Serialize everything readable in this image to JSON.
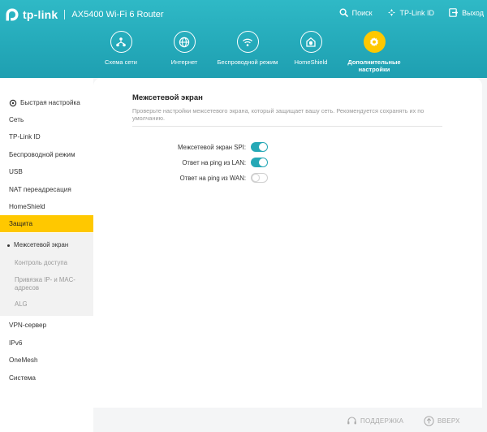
{
  "header": {
    "brand": "tp-link",
    "model": "AX5400 Wi-Fi 6 Router",
    "links": [
      {
        "label": "Поиск",
        "icon": "search-icon"
      },
      {
        "label": "TP-Link ID",
        "icon": "user-id-icon"
      },
      {
        "label": "Выход",
        "icon": "logout-icon"
      }
    ],
    "nav": [
      {
        "label": "Схема сети",
        "icon": "network-map-icon",
        "active": false
      },
      {
        "label": "Интернет",
        "icon": "globe-icon",
        "active": false
      },
      {
        "label": "Беспроводной режим",
        "icon": "wifi-icon",
        "active": false
      },
      {
        "label": "HomeShield",
        "icon": "homeshield-icon",
        "active": false
      },
      {
        "label": "Дополнительные настройки",
        "icon": "gear-icon",
        "active": true
      }
    ],
    "accent_color": "#ffc800",
    "header_color": "#24a9b9"
  },
  "sidebar": {
    "items": [
      {
        "label": "Быстрая настройка",
        "icon": "quick-setup-icon"
      },
      {
        "label": "Сеть"
      },
      {
        "label": "TP-Link ID"
      },
      {
        "label": "Беспроводной режим"
      },
      {
        "label": "USB"
      },
      {
        "label": "NAT переадресация"
      },
      {
        "label": "HomeShield"
      },
      {
        "label": "Защита",
        "active": true
      }
    ],
    "sub_items": [
      {
        "label": "Межсетевой экран",
        "active": true
      },
      {
        "label": "Контроль доступа"
      },
      {
        "label": "Привязка IP- и MAC-адресов"
      },
      {
        "label": "ALG"
      }
    ],
    "more_items": [
      {
        "label": "VPN-сервер"
      },
      {
        "label": "IPv6"
      },
      {
        "label": "OneMesh"
      },
      {
        "label": "Система"
      }
    ]
  },
  "main": {
    "title": "Межсетевой экран",
    "description": "Проверьте настройки межсетевого экрана, который защищает вашу сеть. Рекомендуется сохранять их по умолчанию.",
    "settings": [
      {
        "label": "Межсетевой экран SPI:",
        "enabled": true
      },
      {
        "label": "Ответ на ping из LAN:",
        "enabled": true
      },
      {
        "label": "Ответ на ping из WAN:",
        "enabled": false
      }
    ],
    "toggle_on_color": "#25a8b6"
  },
  "footer": {
    "support_label": "ПОДДЕРЖКА",
    "top_label": "ВВЕРХ"
  }
}
